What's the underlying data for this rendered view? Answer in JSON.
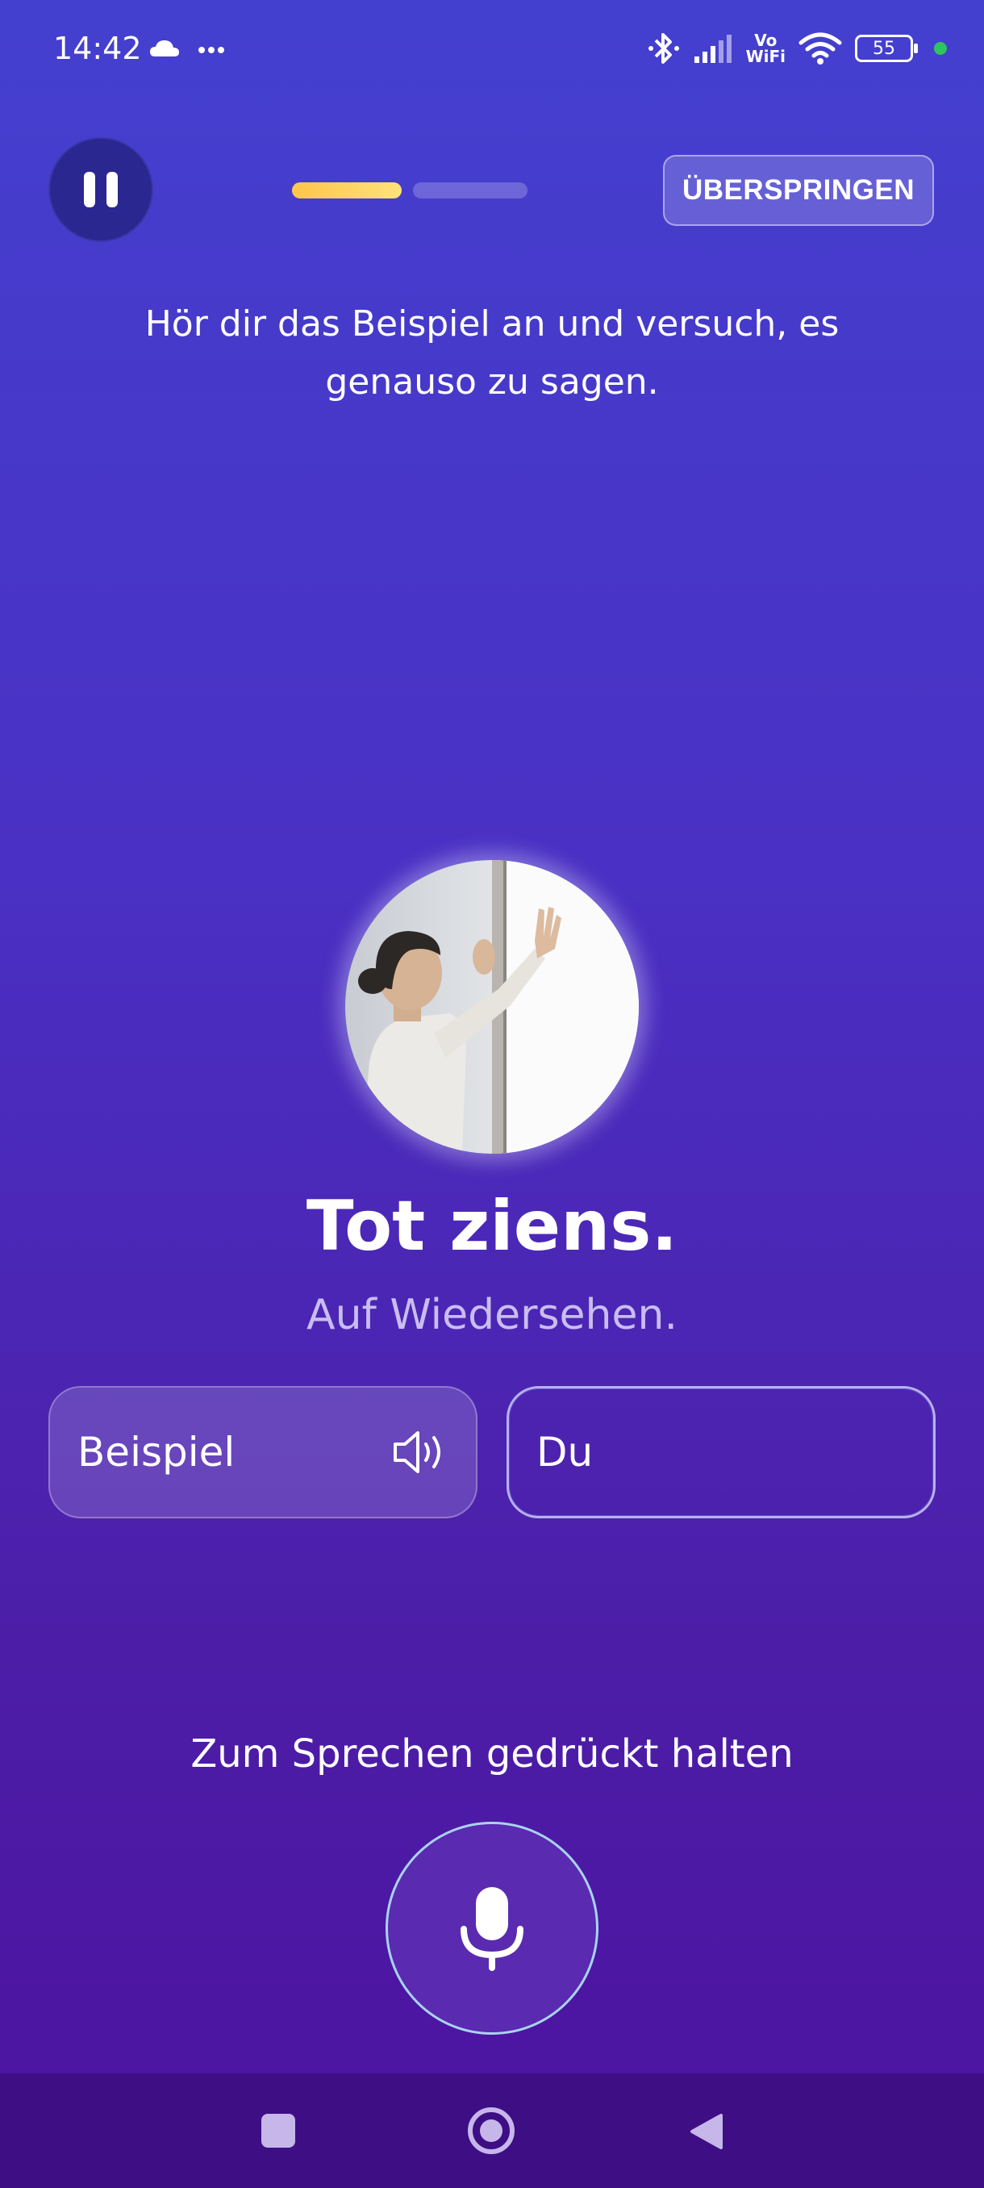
{
  "status_bar": {
    "time": "14:42",
    "left_icons": [
      "cloud-icon",
      "more-dots-icon"
    ],
    "right_icons": [
      "bluetooth-icon",
      "signal-icon",
      "vowifi-icon",
      "wifi-icon",
      "battery-icon"
    ],
    "vowifi_top": "Vo",
    "vowifi_bottom": "WiFi",
    "battery_level": "55",
    "dot_color": "#2ec45e"
  },
  "lesson": {
    "progress": {
      "segments": 2,
      "completed": 1,
      "active_color": "#ffc54a"
    },
    "skip_label": "ÜBERSPRINGEN",
    "instruction": "Hör dir das Beispiel an und versuch, es genauso zu sagen.",
    "phrase": "Tot ziens.",
    "translation": "Auf Wiedersehen.",
    "example_label": "Beispiel",
    "you_label": "Du",
    "hold_to_speak": "Zum Sprechen gedrückt halten"
  },
  "colors": {
    "background_top": "#4440cf",
    "background_bottom": "#4c12a0",
    "accent": "#ffc54a"
  }
}
